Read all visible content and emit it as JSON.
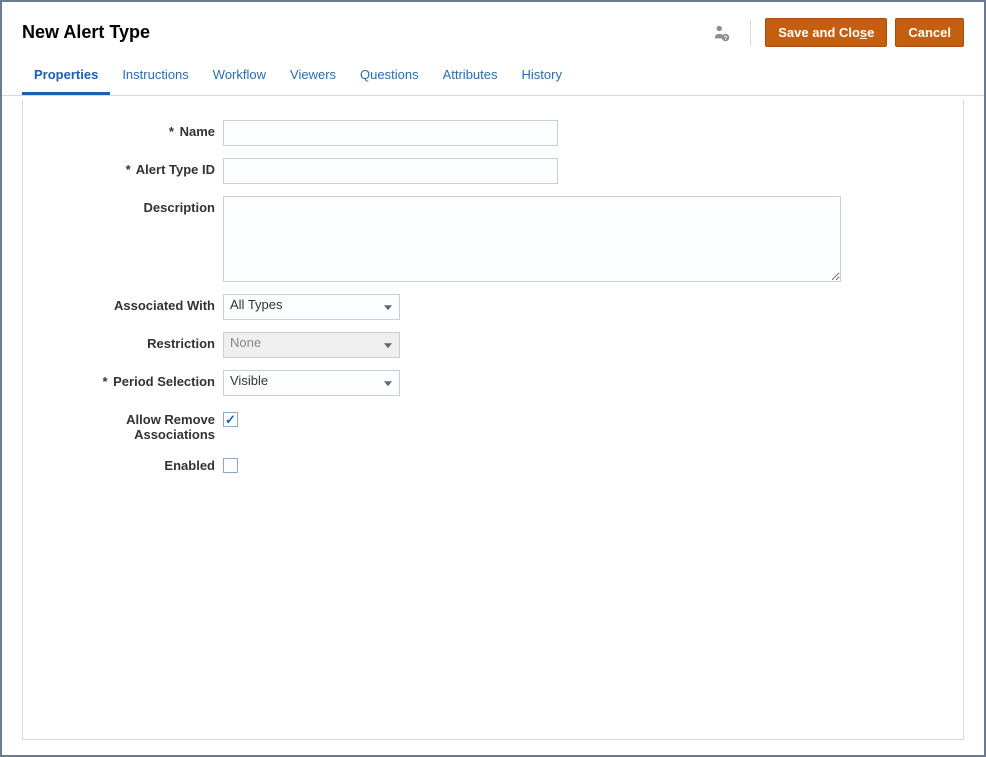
{
  "header": {
    "title": "New Alert Type",
    "save_label": "Save and Close",
    "cancel_label": "Cancel"
  },
  "tabs": [
    {
      "label": "Properties",
      "active": true
    },
    {
      "label": "Instructions",
      "active": false
    },
    {
      "label": "Workflow",
      "active": false
    },
    {
      "label": "Viewers",
      "active": false
    },
    {
      "label": "Questions",
      "active": false
    },
    {
      "label": "Attributes",
      "active": false
    },
    {
      "label": "History",
      "active": false
    }
  ],
  "form": {
    "name": {
      "label": "Name",
      "value": "",
      "required": true
    },
    "alert_type_id": {
      "label": "Alert Type ID",
      "value": "",
      "required": true
    },
    "description": {
      "label": "Description",
      "value": "",
      "required": false
    },
    "associated_with": {
      "label": "Associated With",
      "value": "All Types",
      "required": false
    },
    "restriction": {
      "label": "Restriction",
      "value": "None",
      "required": false,
      "disabled": true
    },
    "period_selection": {
      "label": "Period Selection",
      "value": "Visible",
      "required": true
    },
    "allow_remove_associations": {
      "label": "Allow Remove Associations",
      "checked": true
    },
    "enabled": {
      "label": "Enabled",
      "checked": false
    }
  }
}
